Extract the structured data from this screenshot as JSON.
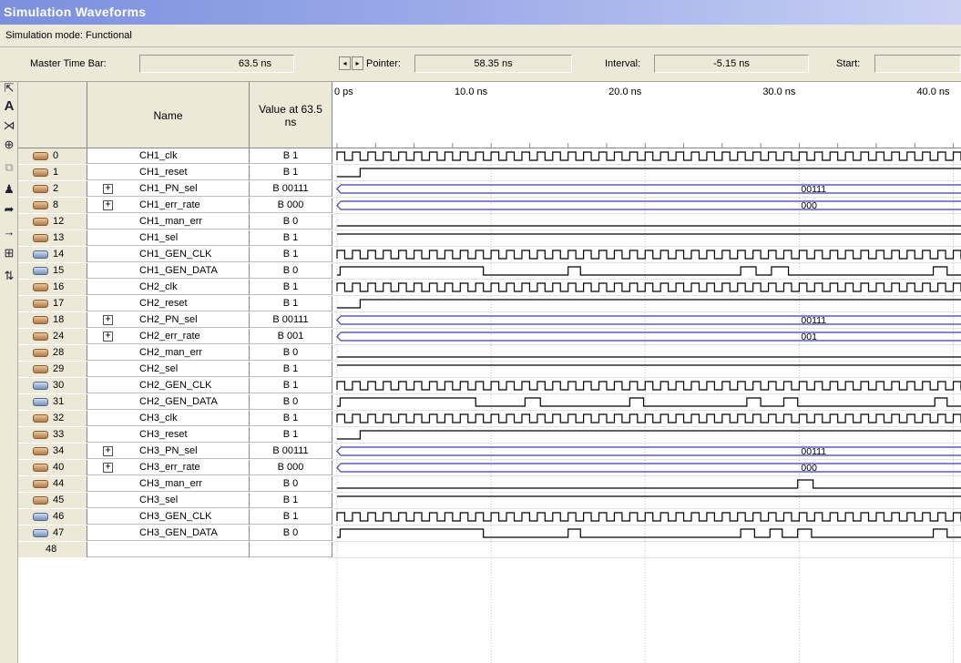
{
  "window": {
    "title": "Simulation Waveforms",
    "mode_text": "Simulation mode: Functional"
  },
  "toolbar": {
    "master_time_bar_label": "Master Time Bar:",
    "master_time_bar_value": "63.5 ns",
    "pointer_label": "Pointer:",
    "pointer_value": "58.35 ns",
    "interval_label": "Interval:",
    "interval_value": "-5.15 ns",
    "start_label": "Start:",
    "start_value": ""
  },
  "tools": [
    "selection-tool-icon",
    "text-tool-icon",
    "waveform-edit-icon",
    "zoom-icon",
    "copy-icon",
    "find-icon",
    "find-next-icon",
    "arrow-right-icon",
    "group-icon",
    "sort-icon"
  ],
  "header": {
    "name": "Name",
    "value_at": "Value at 63.5 ns"
  },
  "time_axis": {
    "labels": [
      "0 ps",
      "10.0 ns",
      "20.0 ns",
      "30.0 ns",
      "40.0 ns"
    ],
    "span_ns": 40.5
  },
  "signals": [
    {
      "index": "0",
      "name": "CH1_clk",
      "value": "B 1",
      "dir": "in",
      "kind": "clock"
    },
    {
      "index": "1",
      "name": "CH1_reset",
      "value": "B 1",
      "dir": "in",
      "kind": "bit",
      "transitions": [
        [
          0,
          0
        ],
        [
          1.5,
          1
        ]
      ]
    },
    {
      "index": "2",
      "name": "CH1_PN_sel",
      "value": "B 00111",
      "dir": "in",
      "kind": "bus",
      "bus_value": "00111",
      "group": true
    },
    {
      "index": "8",
      "name": "CH1_err_rate",
      "value": "B 000",
      "dir": "in",
      "kind": "bus",
      "bus_value": "000",
      "group": true
    },
    {
      "index": "12",
      "name": "CH1_man_err",
      "value": "B 0",
      "dir": "in",
      "kind": "bit",
      "transitions": [
        [
          0,
          0
        ]
      ]
    },
    {
      "index": "13",
      "name": "CH1_sel",
      "value": "B 1",
      "dir": "in",
      "kind": "bit",
      "transitions": [
        [
          0,
          1
        ]
      ]
    },
    {
      "index": "14",
      "name": "CH1_GEN_CLK",
      "value": "B 1",
      "dir": "out",
      "kind": "clock"
    },
    {
      "index": "15",
      "name": "CH1_GEN_DATA",
      "value": "B 0",
      "dir": "out",
      "kind": "bit",
      "transitions": [
        [
          0,
          0
        ],
        [
          0.2,
          1
        ],
        [
          9.5,
          0
        ],
        [
          15.0,
          1
        ],
        [
          15.8,
          0
        ],
        [
          26.2,
          1
        ],
        [
          27.2,
          0
        ],
        [
          28.2,
          1
        ],
        [
          29.3,
          0
        ],
        [
          38.7,
          1
        ],
        [
          39.6,
          0
        ]
      ]
    },
    {
      "index": "16",
      "name": "CH2_clk",
      "value": "B 1",
      "dir": "in",
      "kind": "clock"
    },
    {
      "index": "17",
      "name": "CH2_reset",
      "value": "B 1",
      "dir": "in",
      "kind": "bit",
      "transitions": [
        [
          0,
          0
        ],
        [
          1.5,
          1
        ]
      ]
    },
    {
      "index": "18",
      "name": "CH2_PN_sel",
      "value": "B 00111",
      "dir": "in",
      "kind": "bus",
      "bus_value": "00111",
      "group": true
    },
    {
      "index": "24",
      "name": "CH2_err_rate",
      "value": "B 001",
      "dir": "in",
      "kind": "bus",
      "bus_value": "001",
      "group": true
    },
    {
      "index": "28",
      "name": "CH2_man_err",
      "value": "B 0",
      "dir": "in",
      "kind": "bit",
      "transitions": [
        [
          0,
          0
        ]
      ]
    },
    {
      "index": "29",
      "name": "CH2_sel",
      "value": "B 1",
      "dir": "in",
      "kind": "bit",
      "transitions": [
        [
          0,
          1
        ]
      ]
    },
    {
      "index": "30",
      "name": "CH2_GEN_CLK",
      "value": "B 1",
      "dir": "out",
      "kind": "clock"
    },
    {
      "index": "31",
      "name": "CH2_GEN_DATA",
      "value": "B 0",
      "dir": "out",
      "kind": "bit",
      "transitions": [
        [
          0,
          0
        ],
        [
          0.2,
          1
        ],
        [
          9.0,
          0
        ],
        [
          12.2,
          1
        ],
        [
          13.2,
          0
        ],
        [
          19.0,
          1
        ],
        [
          19.9,
          0
        ],
        [
          26.6,
          1
        ],
        [
          27.5,
          0
        ],
        [
          29.0,
          1
        ],
        [
          29.9,
          0
        ],
        [
          38.8,
          1
        ],
        [
          39.6,
          0
        ]
      ]
    },
    {
      "index": "32",
      "name": "CH3_clk",
      "value": "B 1",
      "dir": "in",
      "kind": "clock"
    },
    {
      "index": "33",
      "name": "CH3_reset",
      "value": "B 1",
      "dir": "in",
      "kind": "bit",
      "transitions": [
        [
          0,
          0
        ],
        [
          1.5,
          1
        ]
      ]
    },
    {
      "index": "34",
      "name": "CH3_PN_sel",
      "value": "B 00111",
      "dir": "in",
      "kind": "bus",
      "bus_value": "00111",
      "group": true
    },
    {
      "index": "40",
      "name": "CH3_err_rate",
      "value": "B 000",
      "dir": "in",
      "kind": "bus",
      "bus_value": "000",
      "group": true
    },
    {
      "index": "44",
      "name": "CH3_man_err",
      "value": "B 0",
      "dir": "in",
      "kind": "bit",
      "transitions": [
        [
          0,
          0
        ],
        [
          29.9,
          1
        ],
        [
          30.9,
          0
        ]
      ]
    },
    {
      "index": "45",
      "name": "CH3_sel",
      "value": "B 1",
      "dir": "in",
      "kind": "bit",
      "transitions": [
        [
          0,
          1
        ]
      ]
    },
    {
      "index": "46",
      "name": "CH3_GEN_CLK",
      "value": "B 1",
      "dir": "out",
      "kind": "clock"
    },
    {
      "index": "47",
      "name": "CH3_GEN_DATA",
      "value": "B 0",
      "dir": "out",
      "kind": "bit",
      "transitions": [
        [
          0,
          0
        ],
        [
          0.2,
          1
        ],
        [
          9.5,
          0
        ],
        [
          15.0,
          1
        ],
        [
          15.8,
          0
        ],
        [
          26.2,
          1
        ],
        [
          27.1,
          0
        ],
        [
          28.1,
          1
        ],
        [
          28.9,
          0
        ],
        [
          29.9,
          1
        ],
        [
          30.8,
          0
        ],
        [
          38.7,
          1
        ],
        [
          39.6,
          0
        ]
      ]
    },
    {
      "index": "48",
      "name": "",
      "value": "",
      "dir": "none",
      "kind": "empty"
    }
  ],
  "clock_period_ns": 1.0,
  "colors": {
    "bus_line": "#3a3ab8",
    "grid_line": "#c0c0c0",
    "wave": "#000000"
  }
}
